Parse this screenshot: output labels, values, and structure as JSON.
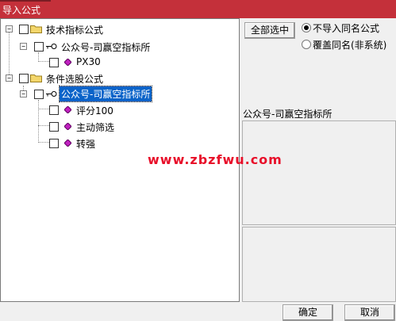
{
  "window": {
    "title": "导入公式"
  },
  "tree": {
    "groups": [
      {
        "label": "技术指标公式",
        "child": {
          "label": "公众号-司赢空指标所",
          "items": [
            "PX30"
          ]
        }
      },
      {
        "label": "条件选股公式",
        "child": {
          "label": "公众号-司赢空指标所",
          "items": [
            "评分100",
            "主动筛选",
            "转强"
          ]
        }
      }
    ]
  },
  "buttons": {
    "select_all": "全部选中",
    "ok": "确定",
    "cancel": "取消"
  },
  "options": {
    "no_import_same_name": "不导入同名公式",
    "overwrite_same_name": "覆盖同名(非系统)",
    "selected": "no_import_same_name"
  },
  "info": {
    "selected_name": "公众号-司赢空指标所"
  },
  "watermark": "www.zbzfwu.com",
  "colors": {
    "titlebar": "#c4303a",
    "selection": "#0a63c9",
    "diamond": "#c020c0",
    "folder": "#f3d66b"
  }
}
